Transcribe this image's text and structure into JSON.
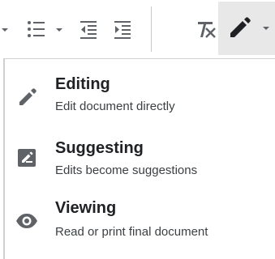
{
  "toolbar": {
    "buttons": [
      {
        "icon": "dropdown-arrow-icon"
      },
      {
        "icon": "bulleted-list-icon"
      },
      {
        "icon": "dropdown-arrow-icon"
      },
      {
        "icon": "decrease-indent-icon"
      },
      {
        "icon": "increase-indent-icon"
      },
      {
        "icon": "clear-formatting-icon"
      },
      {
        "icon": "pencil-icon"
      },
      {
        "icon": "dropdown-arrow-icon"
      }
    ]
  },
  "mode_menu": {
    "items": [
      {
        "title": "Editing",
        "description": "Edit document directly",
        "icon": "pencil-icon"
      },
      {
        "title": "Suggesting",
        "description": "Edits become suggestions",
        "icon": "suggest-icon"
      },
      {
        "title": "Viewing",
        "description": "Read or print final document",
        "icon": "eye-icon"
      }
    ]
  },
  "colors": {
    "icon": "#5f6368",
    "icon_dark": "#202124",
    "active_bg": "#e8e8e8"
  }
}
